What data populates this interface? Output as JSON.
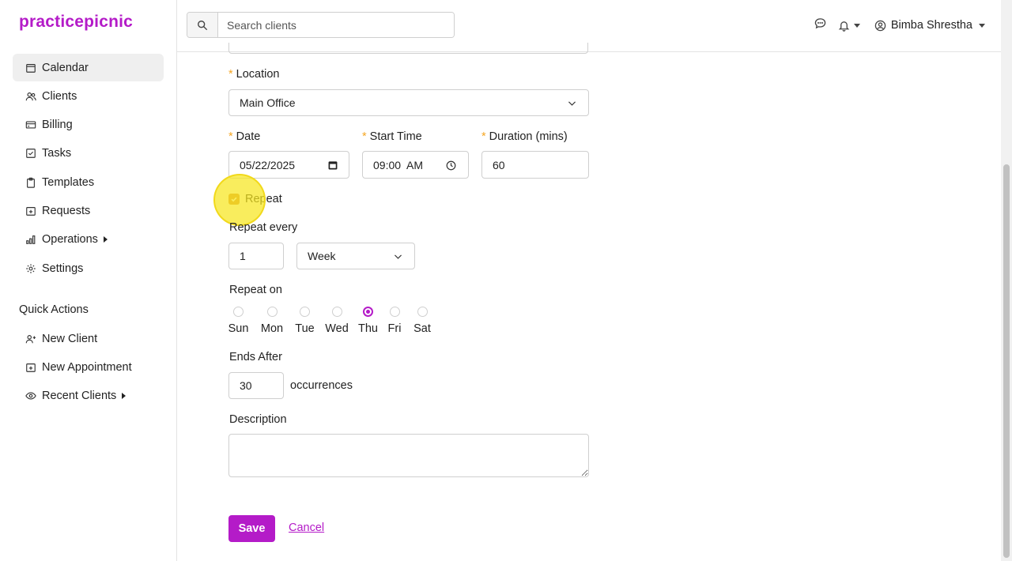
{
  "app": {
    "logo": "practicepicnic"
  },
  "sidebar": {
    "items": [
      {
        "label": "Calendar",
        "icon": "calendar-icon",
        "active": true
      },
      {
        "label": "Clients",
        "icon": "users-icon"
      },
      {
        "label": "Billing",
        "icon": "credit-card-icon"
      },
      {
        "label": "Tasks",
        "icon": "checkbox-icon"
      },
      {
        "label": "Templates",
        "icon": "clipboard-icon"
      },
      {
        "label": "Requests",
        "icon": "calendar-plus-icon"
      },
      {
        "label": "Operations",
        "icon": "bar-chart-icon",
        "expandable": true
      },
      {
        "label": "Settings",
        "icon": "gear-icon"
      }
    ],
    "quick_actions_title": "Quick Actions",
    "quick_actions": [
      {
        "label": "New Client",
        "icon": "user-plus-icon"
      },
      {
        "label": "New Appointment",
        "icon": "calendar-plus-icon"
      },
      {
        "label": "Recent Clients",
        "icon": "eye-icon",
        "expandable": true
      }
    ]
  },
  "header": {
    "search_placeholder": "Search clients",
    "user_name": "Bimba Shrestha"
  },
  "form": {
    "location": {
      "label": "Location",
      "value": "Main Office"
    },
    "date": {
      "label": "Date",
      "value": "05/22/2025"
    },
    "start_time": {
      "label": "Start Time",
      "value": "09:00  AM"
    },
    "duration": {
      "label": "Duration (mins)",
      "value": "60"
    },
    "repeat": {
      "label": "Repeat",
      "checked": true
    },
    "repeat_every": {
      "label": "Repeat every",
      "value": "1",
      "unit": "Week"
    },
    "repeat_on": {
      "label": "Repeat on",
      "days": [
        {
          "label": "Sun",
          "checked": false
        },
        {
          "label": "Mon",
          "checked": false
        },
        {
          "label": "Tue",
          "checked": false
        },
        {
          "label": "Wed",
          "checked": false
        },
        {
          "label": "Thu",
          "checked": true
        },
        {
          "label": "Fri",
          "checked": false
        },
        {
          "label": "Sat",
          "checked": false
        }
      ]
    },
    "ends_after": {
      "label": "Ends After",
      "value": "30",
      "suffix": "occurrences"
    },
    "description": {
      "label": "Description",
      "value": ""
    },
    "save_label": "Save",
    "cancel_label": "Cancel"
  },
  "colors": {
    "brand": "#b41bc8",
    "required": "#f5a623",
    "checkbox": "#d78c3a"
  }
}
